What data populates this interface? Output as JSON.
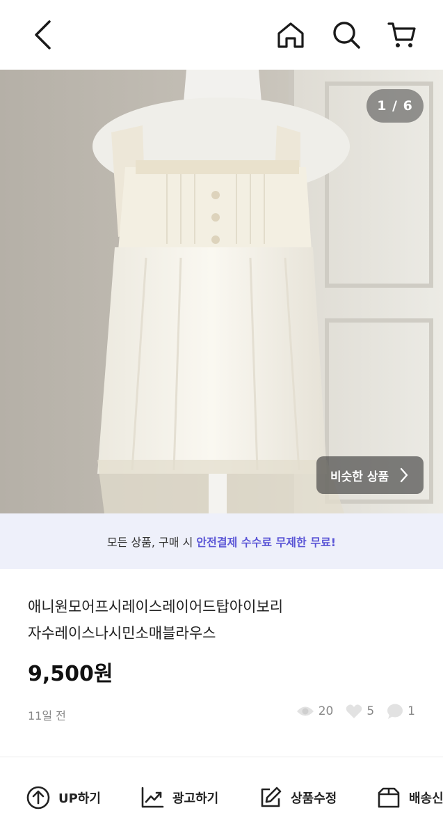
{
  "photo": {
    "pager": "1 / 6",
    "similar_label": "비슷한 상품"
  },
  "banner": {
    "prefix": "모든 상품, 구매 시 ",
    "highlight": "안전결제 수수료 무제한 무료!"
  },
  "product": {
    "title_line1": "애니원모어프시레이스레이어드탑아이보리",
    "title_line2": "자수레이스나시민소매블라우스",
    "price": "9,500원",
    "posted": "11일 전",
    "views": "20",
    "likes": "5",
    "chats": "1"
  },
  "actions": {
    "up": "UP하기",
    "ad": "광고하기",
    "edit": "상품수정",
    "ship": "배송신청"
  },
  "colors": {
    "accent": "#5a55d6",
    "banner_bg": "#eef0fa",
    "muted": "#888888"
  }
}
